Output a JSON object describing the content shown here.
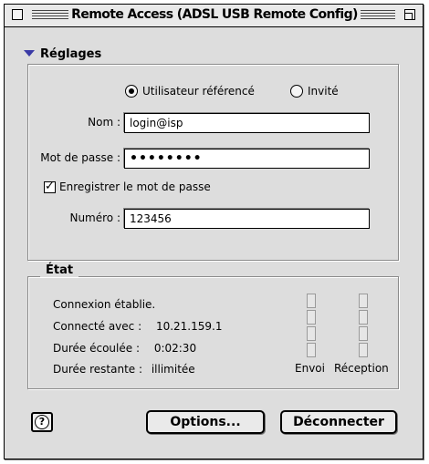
{
  "window": {
    "title": "Remote Access (ADSL USB Remote Config)"
  },
  "settings": {
    "disclosure_label": "Réglages",
    "radio_user": "Utilisateur référencé",
    "radio_guest": "Invité",
    "selected": "user",
    "name_label": "Nom :",
    "name_value": "login@isp",
    "password_label": "Mot de passe :",
    "password_mask": "••••••••",
    "save_password_label": "Enregistrer le mot de passe",
    "save_password_checked": true,
    "number_label": "Numéro :",
    "number_value": "123456"
  },
  "state": {
    "legend": "État",
    "status": "Connexion établie.",
    "connected_with_label": "Connecté avec :",
    "connected_with_value": "10.21.159.1",
    "elapsed_label": "Durée écoulée :",
    "elapsed_value": "0:02:30",
    "remaining_label": "Durée restante :",
    "remaining_value": "illimitée",
    "send_label": "Envoi",
    "receive_label": "Réception"
  },
  "buttons": {
    "help": "?",
    "options": "Options...",
    "disconnect": "Déconnecter"
  }
}
